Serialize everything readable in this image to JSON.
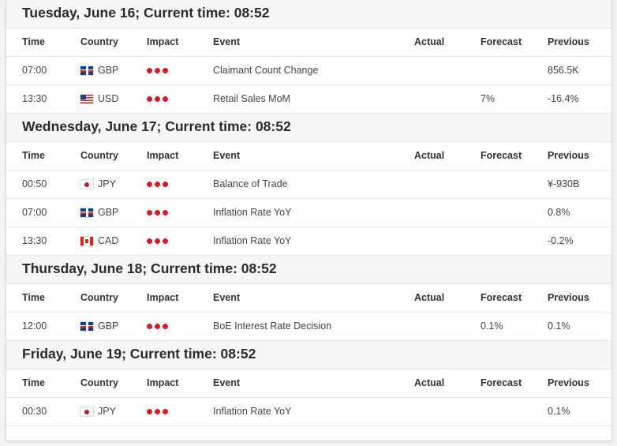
{
  "columns": {
    "time": "Time",
    "country": "Country",
    "impact": "Impact",
    "event": "Event",
    "actual": "Actual",
    "forecast": "Forecast",
    "previous": "Previous"
  },
  "impact_color": "#c9202c",
  "days": [
    {
      "title": "Tuesday, June 16; Current time: 08:52",
      "events": [
        {
          "time": "07:00",
          "currency": "GBP",
          "flag": "gb-flag-icon",
          "impact": 3,
          "event": "Claimant Count Change",
          "actual": "",
          "forecast": "",
          "previous": "856.5K"
        },
        {
          "time": "13:30",
          "currency": "USD",
          "flag": "us-flag-icon",
          "impact": 3,
          "event": "Retail Sales MoM",
          "actual": "",
          "forecast": "7%",
          "previous": "-16.4%"
        }
      ]
    },
    {
      "title": "Wednesday, June 17; Current time: 08:52",
      "events": [
        {
          "time": "00:50",
          "currency": "JPY",
          "flag": "jp-flag-icon",
          "impact": 3,
          "event": "Balance of Trade",
          "actual": "",
          "forecast": "",
          "previous": "¥-930B"
        },
        {
          "time": "07:00",
          "currency": "GBP",
          "flag": "gb-flag-icon",
          "impact": 3,
          "event": "Inflation Rate YoY",
          "actual": "",
          "forecast": "",
          "previous": "0.8%"
        },
        {
          "time": "13:30",
          "currency": "CAD",
          "flag": "ca-flag-icon",
          "impact": 3,
          "event": "Inflation Rate YoY",
          "actual": "",
          "forecast": "",
          "previous": "-0.2%"
        }
      ]
    },
    {
      "title": "Thursday, June 18; Current time: 08:52",
      "events": [
        {
          "time": "12:00",
          "currency": "GBP",
          "flag": "gb-flag-icon",
          "impact": 3,
          "event": "BoE Interest Rate Decision",
          "actual": "",
          "forecast": "0.1%",
          "previous": "0.1%"
        }
      ]
    },
    {
      "title": "Friday, June 19; Current time: 08:52",
      "events": [
        {
          "time": "00:30",
          "currency": "JPY",
          "flag": "jp-flag-icon",
          "impact": 3,
          "event": "Inflation Rate YoY",
          "actual": "",
          "forecast": "",
          "previous": "0.1%"
        }
      ]
    }
  ]
}
